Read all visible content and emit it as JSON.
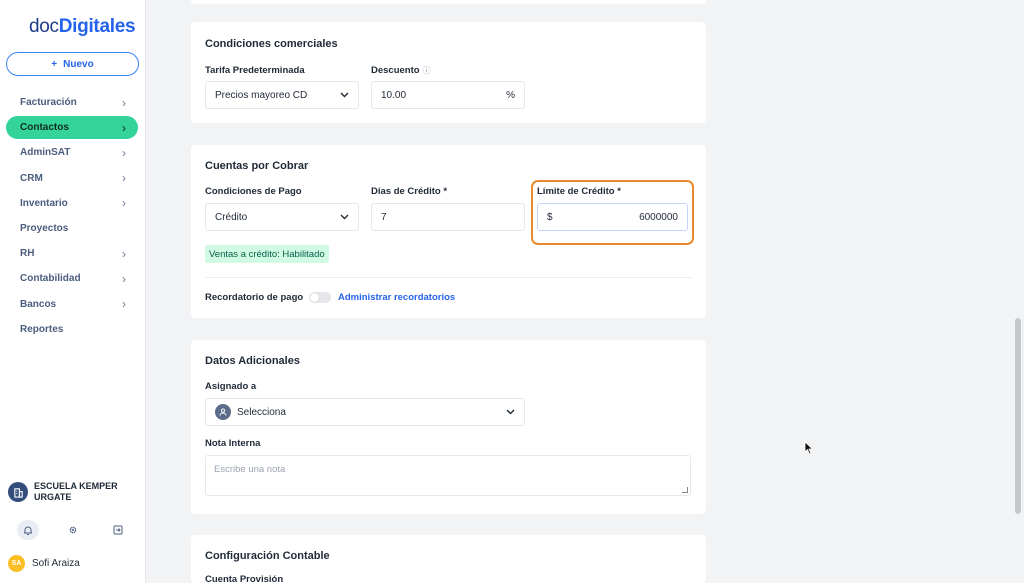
{
  "sidebar": {
    "logo_part1": "doc",
    "logo_part2": "Digitales",
    "new_button": "Nuevo",
    "nav": [
      {
        "label": "Facturación",
        "chevron": true,
        "active": false
      },
      {
        "label": "Contactos",
        "chevron": true,
        "active": true
      },
      {
        "label": "AdminSAT",
        "chevron": true,
        "active": false
      },
      {
        "label": "CRM",
        "chevron": true,
        "active": false
      },
      {
        "label": "Inventario",
        "chevron": true,
        "active": false
      },
      {
        "label": "Proyectos",
        "chevron": false,
        "active": false
      },
      {
        "label": "RH",
        "chevron": true,
        "active": false
      },
      {
        "label": "Contabilidad",
        "chevron": true,
        "active": false
      },
      {
        "label": "Bancos",
        "chevron": true,
        "active": false
      },
      {
        "label": "Reportes",
        "chevron": false,
        "active": false
      }
    ],
    "company_name": "ESCUELA KEMPER URGATE",
    "user_initials": "SA",
    "user_name": "Sofi Araiza"
  },
  "commercial": {
    "title": "Condiciones comerciales",
    "rate_label": "Tarifa Predeterminada",
    "rate_value": "Precios mayoreo CD",
    "discount_label": "Descuento",
    "discount_value": "10.00",
    "discount_unit": "%"
  },
  "receivables": {
    "title": "Cuentas por Cobrar",
    "payment_label": "Condiciones de Pago",
    "payment_value": "Crédito",
    "days_label": "Días de Crédito *",
    "days_value": "7",
    "limit_label": "Límite de Crédito *",
    "limit_currency": "$",
    "limit_value": "6000000",
    "status_badge": "Ventas a crédito: Habilitado",
    "reminder_label": "Recordatorio de pago",
    "reminder_link": "Administrar recordatorios"
  },
  "additional": {
    "title": "Datos Adicionales",
    "assigned_label": "Asignado a",
    "assigned_value": "Selecciona",
    "note_label": "Nota Interna",
    "note_placeholder": "Escribe una nota"
  },
  "accounting": {
    "title": "Configuración Contable",
    "provision_label": "Cuenta Provisión"
  },
  "colors": {
    "accent": "#2563eb",
    "active_nav": "#34d399",
    "highlight": "#e8892e",
    "badge_bg": "#d1fae5"
  }
}
